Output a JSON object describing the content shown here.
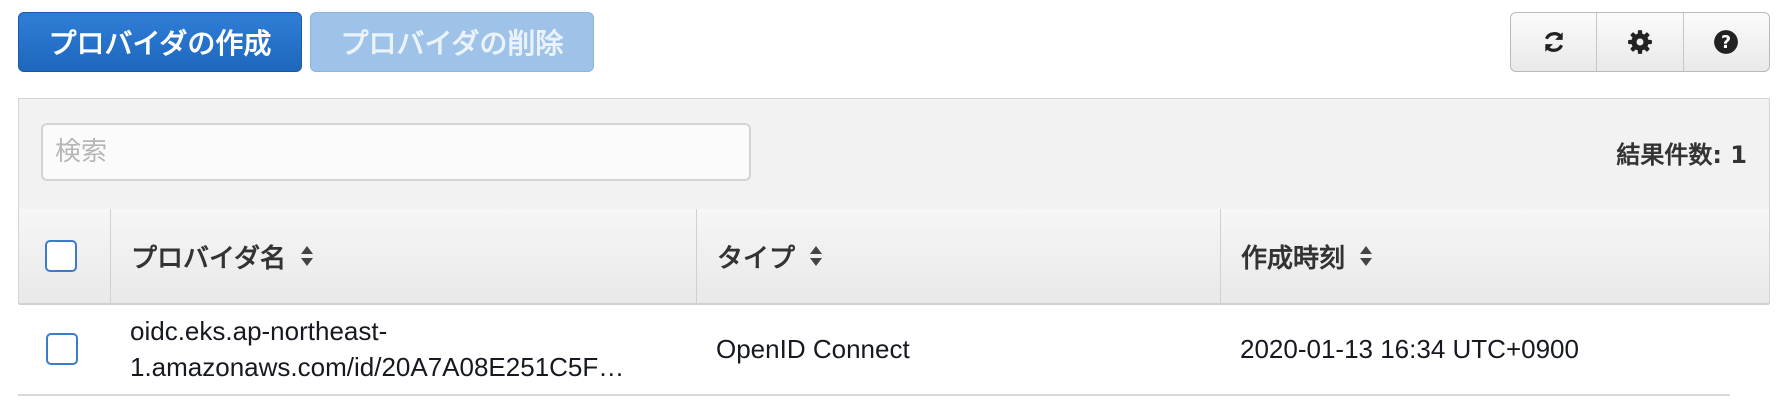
{
  "toolbar": {
    "create_label": "プロバイダの作成",
    "delete_label": "プロバイダの削除",
    "icons": [
      "refresh-icon",
      "gear-icon",
      "help-icon"
    ]
  },
  "filter": {
    "search_placeholder": "検索",
    "search_value": "",
    "result_count": "結果件数: 1"
  },
  "table": {
    "columns": [
      {
        "label": "プロバイダ名"
      },
      {
        "label": "タイプ"
      },
      {
        "label": "作成時刻"
      }
    ],
    "rows": [
      {
        "name_line1": "oidc.eks.ap-northeast-",
        "name_line2": "1.amazonaws.com/id/20A7A08E251C5F…",
        "type": "OpenID Connect",
        "created": "2020-01-13 16:34 UTC+0900"
      }
    ]
  },
  "colors": {
    "primary": "#1e67be",
    "disabled": "#9ec2e8",
    "checkbox_border": "#3d7cc9"
  }
}
